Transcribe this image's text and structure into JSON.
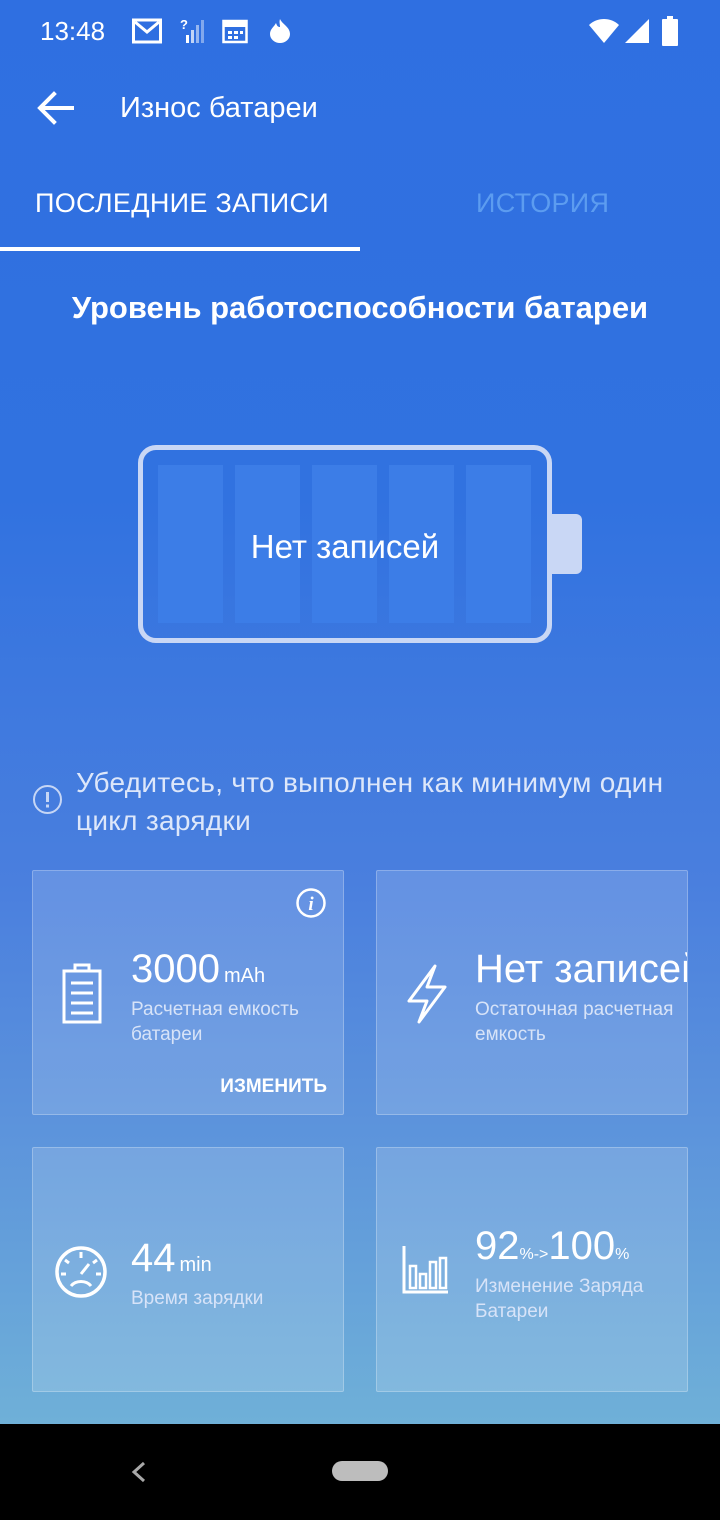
{
  "status_bar": {
    "time": "13:48",
    "icons_left": [
      "gmail-icon",
      "no-signal-icon",
      "calendar-icon",
      "fire-icon"
    ],
    "icons_right": [
      "wifi-icon",
      "signal-icon",
      "battery-icon"
    ]
  },
  "app_bar": {
    "title": "Износ батареи",
    "back_icon": "arrow-left-icon"
  },
  "tabs": [
    {
      "label": "ПОСЛЕДНИЕ ЗАПИСИ",
      "active": true
    },
    {
      "label": "ИСТОРИЯ",
      "active": false
    }
  ],
  "health": {
    "title": "Уровень работоспособности батареи",
    "battery_label": "Нет записей"
  },
  "hint": {
    "icon": "info-circle-icon",
    "text": "Убедитесь, что выполнен как минимум один цикл зарядки"
  },
  "cards": {
    "capacity": {
      "value": "3000",
      "unit": "mAh",
      "label": "Расчетная емкость батареи",
      "action": "ИЗМЕНИТЬ",
      "icon": "battery-document-icon",
      "info_icon": "info-icon"
    },
    "residual": {
      "value": "Нет записей",
      "label": "Остаточная расчетная емкость",
      "icon": "lightning-icon"
    },
    "charge_time": {
      "value": "44",
      "unit": "min",
      "label": "Время зарядки",
      "icon": "speedometer-icon"
    },
    "charge_change": {
      "from": "92",
      "from_unit": "%->",
      "to": "100",
      "to_unit": "%",
      "label": "Изменение Заряда Батареи",
      "icon": "bar-chart-icon"
    }
  },
  "colors": {
    "background_top": "#2f6fe1",
    "background_bottom": "#6fb0d8",
    "inactive_tab": "#5c9cf0"
  }
}
